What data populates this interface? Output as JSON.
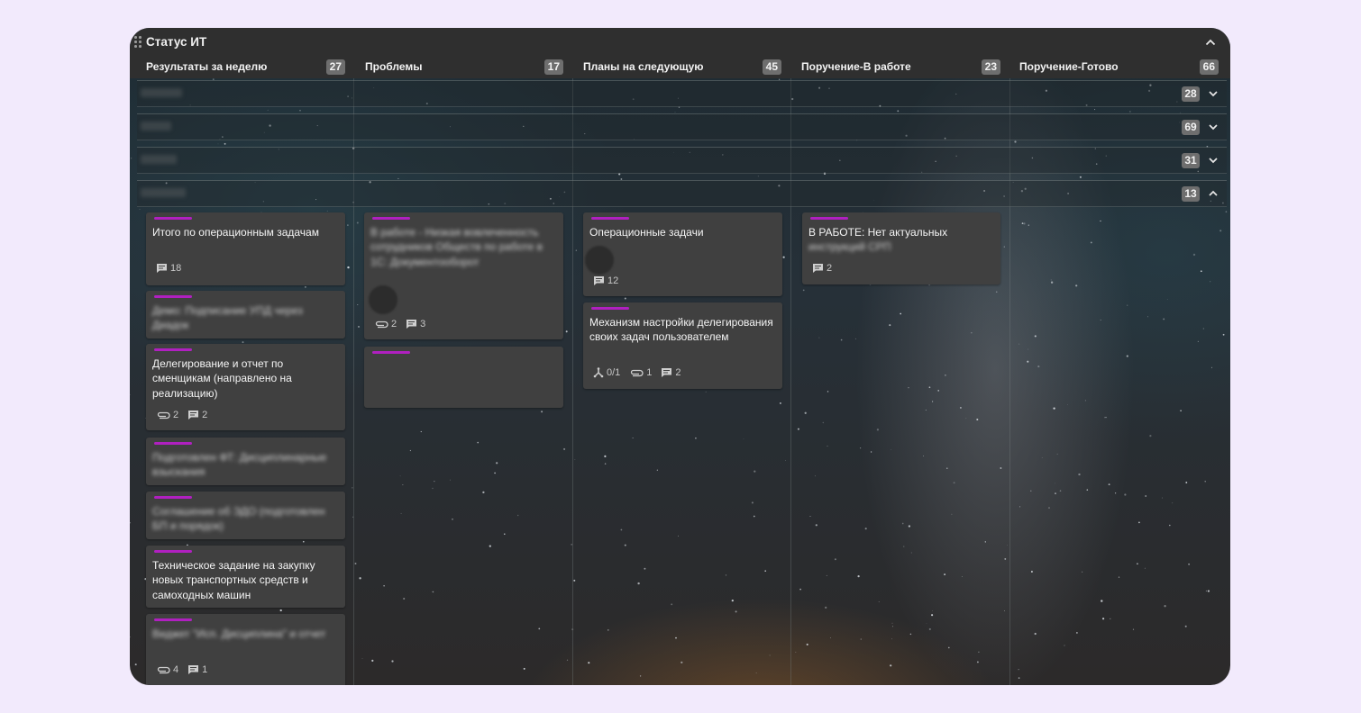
{
  "board": {
    "title": "Статус ИТ",
    "columns": [
      {
        "title": "Результаты за неделю",
        "count": "27"
      },
      {
        "title": "Проблемы",
        "count": "17"
      },
      {
        "title": "Планы на следующую",
        "count": "45"
      },
      {
        "title": "Поручение-В работе",
        "count": "23"
      },
      {
        "title": "Поручение-Готово",
        "count": "66"
      }
    ],
    "swimlanes": [
      {
        "count": "28",
        "state": "collapsed"
      },
      {
        "count": "69",
        "state": "collapsed"
      },
      {
        "count": "31",
        "state": "collapsed"
      },
      {
        "count": "13",
        "state": "expanded"
      }
    ]
  },
  "cards": {
    "c1": {
      "title": "Итого по операционным задачам",
      "comments": "18"
    },
    "c2": {
      "title": "Демо: Подписание УПД через Диадок"
    },
    "c3": {
      "title": "Делегирование и отчет по сменщикам (направлено на реализацию)",
      "attachments": "2",
      "comments": "2"
    },
    "c4": {
      "title": "Подготовлен ФТ: Дисциплинарные взыскания"
    },
    "c5": {
      "title": "Соглашение об ЭДО (подготовлен БП и порядок)"
    },
    "c6": {
      "title": "Техническое задание на закупку новых транспортных средств и самоходных машин"
    },
    "c7": {
      "title": "Виджет \"Исп. Дисциплина\" и отчет",
      "attachments": "4",
      "comments": "1"
    },
    "p1": {
      "title": "В работе - Низкая вовлеченность сотрудников Обществ по работе в 1С: Документооборот",
      "attachments": "2",
      "comments": "3"
    },
    "n1": {
      "title": "Операционные задачи",
      "comments": "12"
    },
    "n2": {
      "title": "Механизм настройки делегирования своих задач пользователем",
      "subtasks": "0/1",
      "attachments": "1",
      "comments": "2"
    },
    "w1": {
      "title_visible": "В РАБОТЕ: Нет актуальных",
      "title_blurred": "инструкций СРП",
      "comments": "2"
    }
  },
  "colors": {
    "accent_stripe": "#b020c0",
    "card_bg": "#404040",
    "header_bg": "#2f2f2f",
    "page_bg": "#f2eafc"
  },
  "icons": [
    "drag-handle-icon",
    "chevron-up-icon",
    "chevron-down-icon",
    "comment-icon",
    "attachment-icon",
    "subtask-icon"
  ]
}
